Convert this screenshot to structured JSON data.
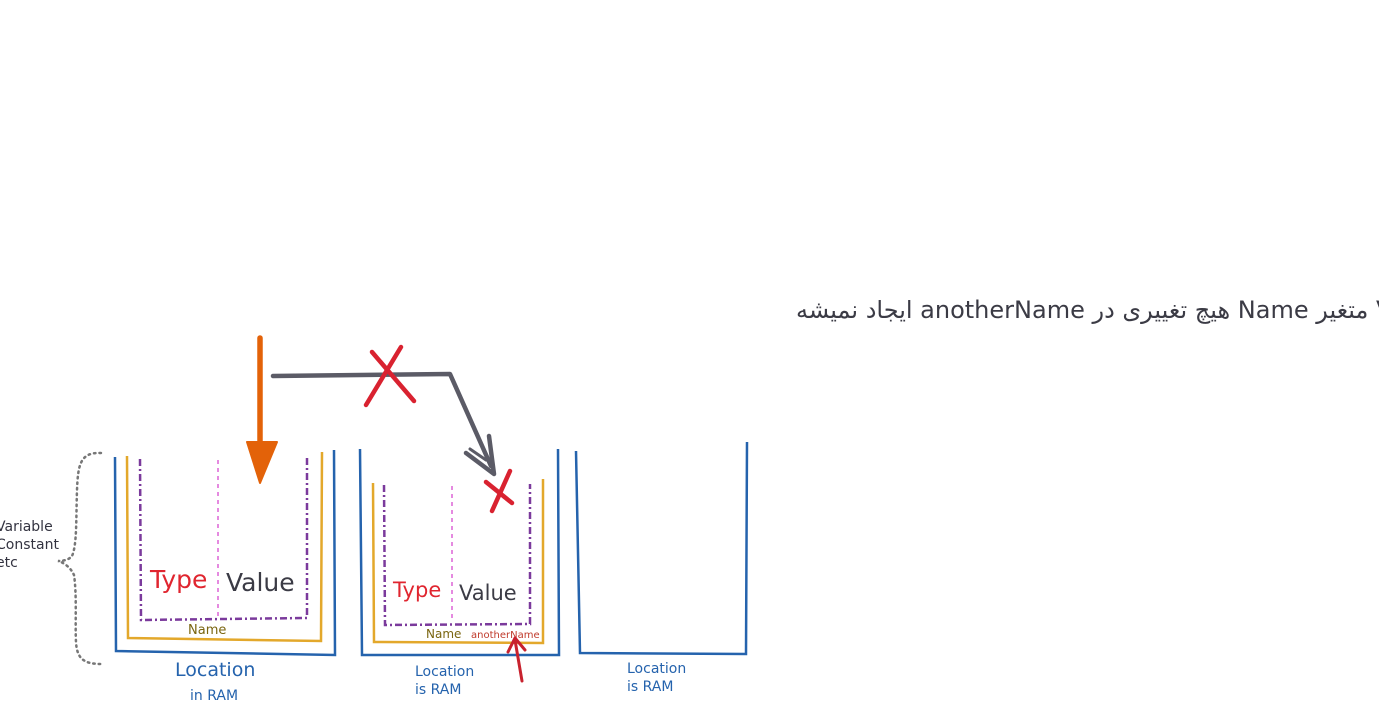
{
  "title": "با تغییر Value متغیر Name هیچ تغییری در anotherName ایجاد نمیشه",
  "brace_labels": [
    "Variable",
    "Constant",
    "etc"
  ],
  "box1": {
    "type_label": "Type",
    "value_label": "Value",
    "name_label": "Name",
    "location_line1": "Location",
    "location_line2": "in RAM"
  },
  "box2": {
    "type_label": "Type",
    "value_label": "Value",
    "name_label": "Name",
    "another_name_label": "anotherName",
    "location_line1": "Location",
    "location_line2": "is RAM"
  },
  "box3": {
    "location_line1": "Location",
    "location_line2": "is RAM"
  },
  "colors": {
    "location": "#2563ad",
    "name_box": "#e3a82b",
    "name_text": "#7a6510",
    "type_box": "#7b3a9c",
    "divider": "#e58ae0",
    "type_text": "#e0252f",
    "value_text": "#3b3b45",
    "orange_arrow": "#e36209",
    "grey_arrow": "#5b5b66",
    "red_cross": "#d92230",
    "brace": "#777777"
  }
}
